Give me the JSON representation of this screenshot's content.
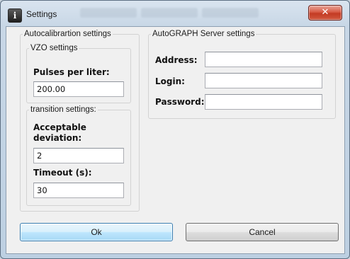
{
  "window": {
    "title": "Settings",
    "close_symbol": "✕",
    "app_icon_glyph": "i"
  },
  "autocalibration": {
    "legend": "Autocalibrartion settings",
    "vzo": {
      "legend": "VZO settings",
      "pulses_label": "Pulses per liter:",
      "pulses_value": "200.00"
    },
    "transition": {
      "legend": "transition settings:",
      "deviation_label_line1": "Acceptable",
      "deviation_label_line2": "deviation:",
      "deviation_value": "2",
      "timeout_label": "Timeout (s):",
      "timeout_value": "30"
    }
  },
  "server": {
    "legend": "AutoGRAPH Server settings",
    "address_label": "Address:",
    "address_value": "",
    "login_label": "Login:",
    "login_value": "",
    "password_label": "Password:",
    "password_value": ""
  },
  "buttons": {
    "ok": "Ok",
    "cancel": "Cancel"
  }
}
